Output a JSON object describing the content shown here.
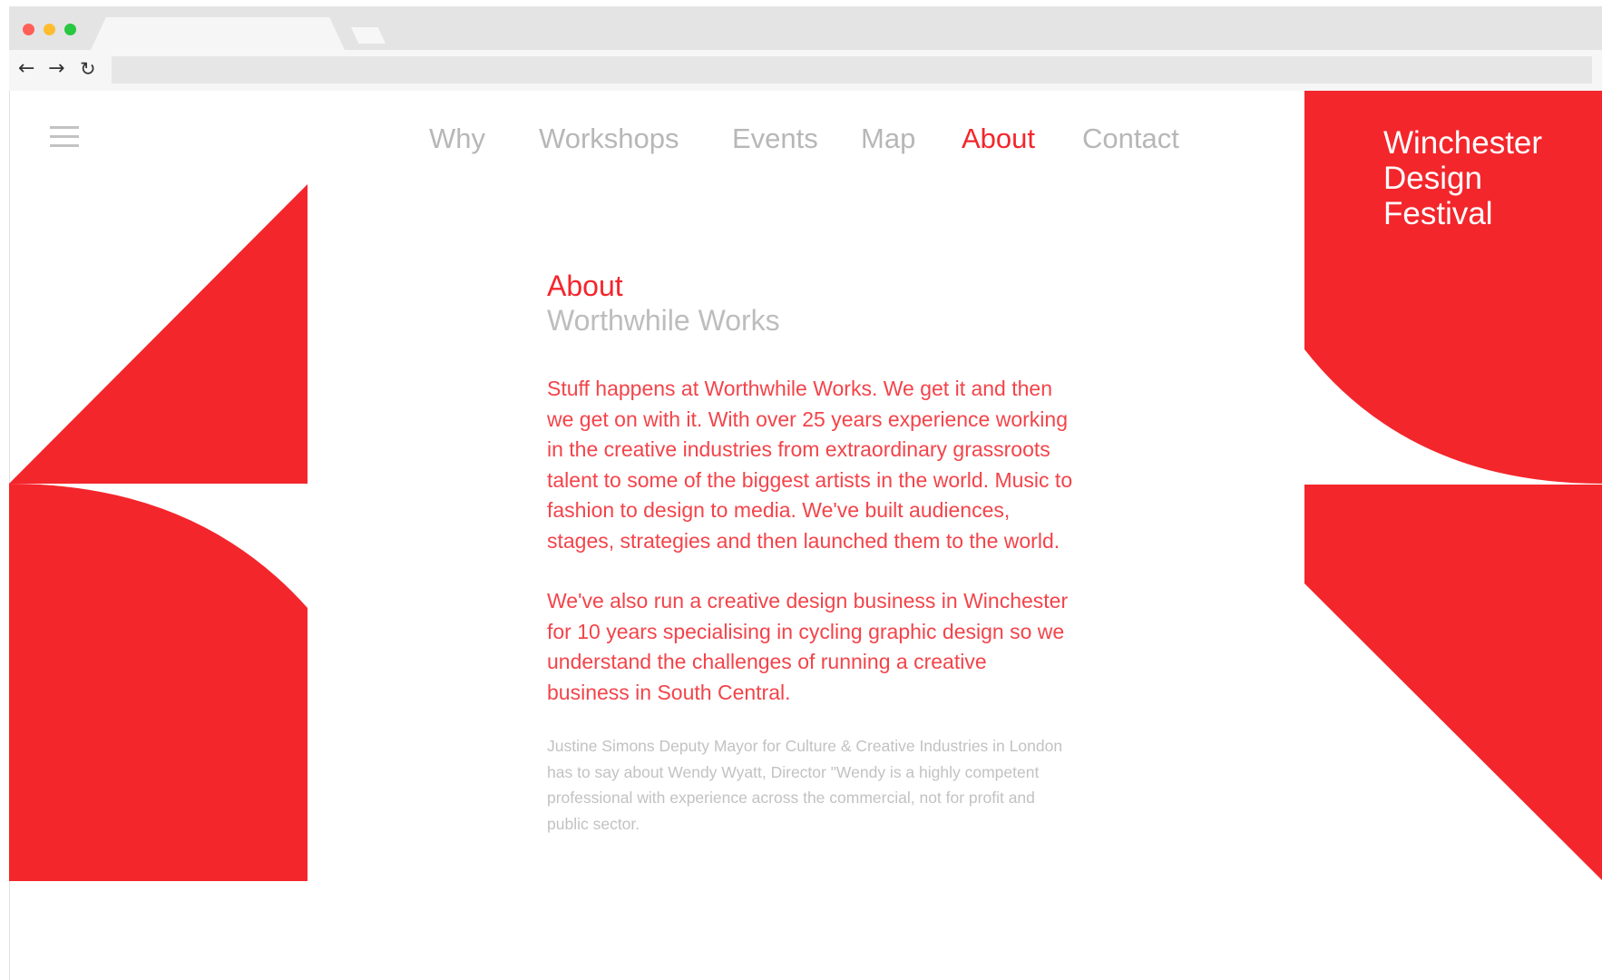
{
  "browser": {
    "traffic_lights": {
      "close": "#ff5f57",
      "minimize": "#febc2e",
      "maximize": "#28c840"
    },
    "icons": {
      "back": "arrow-left-icon",
      "forward": "arrow-right-icon",
      "reload": "reload-icon"
    },
    "back_glyph": "←",
    "forward_glyph": "→",
    "reload_glyph": "↻",
    "url": ""
  },
  "site": {
    "logo_lines": [
      "Winchester",
      "Design",
      "Festival"
    ],
    "menu_icon": "hamburger-menu-icon",
    "nav": [
      {
        "label": "Why",
        "active": false
      },
      {
        "label": "Workshops",
        "active": false
      },
      {
        "label": "Events",
        "active": false
      },
      {
        "label": "Map",
        "active": false
      },
      {
        "label": "About",
        "active": true
      },
      {
        "label": "Contact",
        "active": false
      }
    ]
  },
  "page": {
    "title": "About",
    "subtitle": "Worthwhile Works",
    "paragraphs": [
      "Stuff happens at Worthwhile Works. We get it and then we get on with it. With over 25 years experience working in the creative industries from extraordinary grassroots talent to some of the biggest artists in the world. Music to fashion to design to media. We've built audiences, stages, strategies and then launched them to the world.",
      "We've also run a creative design business in Winchester for 10 years specialising in cycling graphic design so we understand the challenges of running a creative business in South Central."
    ],
    "quote": "Justine Simons Deputy Mayor for Culture & Creative Industries in London has to say about Wendy Wyatt, Director \"Wendy is a highly competent professional with experience across the commercial, not for profit and public sector."
  },
  "colors": {
    "brand_red": "#f3262c",
    "body_red": "#f2444a",
    "nav_gray": "#b7b7b7",
    "quote_gray": "#c2c2c2"
  }
}
